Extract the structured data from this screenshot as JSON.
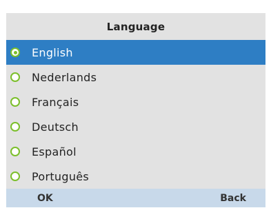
{
  "header": {
    "title": "Language"
  },
  "languages": [
    {
      "label": "English",
      "selected": true
    },
    {
      "label": "Nederlands",
      "selected": false
    },
    {
      "label": "Français",
      "selected": false
    },
    {
      "label": "Deutsch",
      "selected": false
    },
    {
      "label": "Español",
      "selected": false
    },
    {
      "label": "Português",
      "selected": false
    }
  ],
  "softkeys": {
    "left_label": "OK",
    "right_label": "Back"
  },
  "colors": {
    "selection": "#2e7ec4",
    "radio": "#7bbf2a",
    "background": "#e2e2e2",
    "softkey_bar": "#c8d9ea"
  },
  "icons": {
    "radio": "radio-button-icon"
  }
}
